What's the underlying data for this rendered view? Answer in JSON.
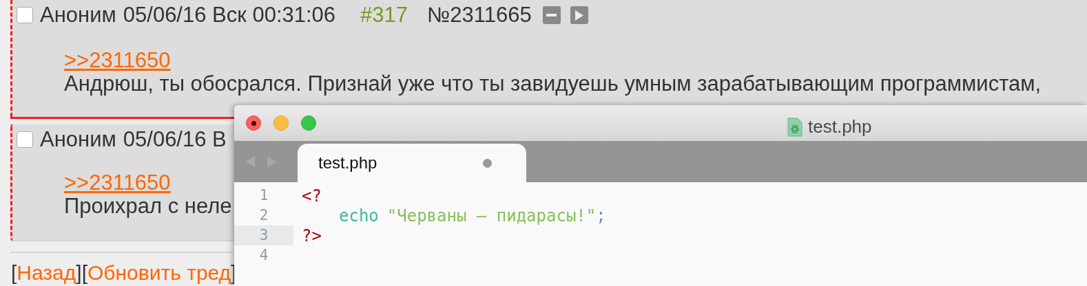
{
  "posts": [
    {
      "checked": false,
      "author": "Аноним",
      "datetime": "05/06/16 Вск 00:31:06",
      "index": "#317",
      "number": "№2311665",
      "reply_link": ">>2311650",
      "message": "Андрюш, ты обосрался. Признай уже что ты завидуешь умным зарабатывающим программистам,"
    },
    {
      "checked": false,
      "author": "Аноним",
      "datetime": "05/06/16 В",
      "reply_link": ">>2311650",
      "message": "Проихрал с неле"
    }
  ],
  "nav": [
    {
      "kind": "bracket",
      "text": "["
    },
    {
      "kind": "link",
      "text": "Назад"
    },
    {
      "kind": "bracket",
      "text": "]["
    },
    {
      "kind": "link",
      "text": "Обновить тред"
    },
    {
      "kind": "bracket",
      "text": "]"
    }
  ],
  "editor": {
    "title": "test.php",
    "tabs": [
      {
        "label": "test.php",
        "selected": true,
        "modified": true
      }
    ],
    "lines": [
      {
        "number": "1",
        "current": false,
        "tokens": [
          {
            "kind": "tag",
            "text": "<?"
          }
        ]
      },
      {
        "number": "2",
        "current": false,
        "tokens": [
          {
            "kind": "keyword",
            "text": "echo"
          },
          {
            "kind": "string",
            "text": "\"Черваны – пидарасы!\""
          },
          {
            "kind": "punct",
            "text": ";"
          }
        ]
      },
      {
        "number": "3",
        "current": true,
        "tokens": [
          {
            "kind": "tag",
            "text": "?>"
          }
        ]
      },
      {
        "number": "4",
        "current": false
      }
    ]
  }
}
